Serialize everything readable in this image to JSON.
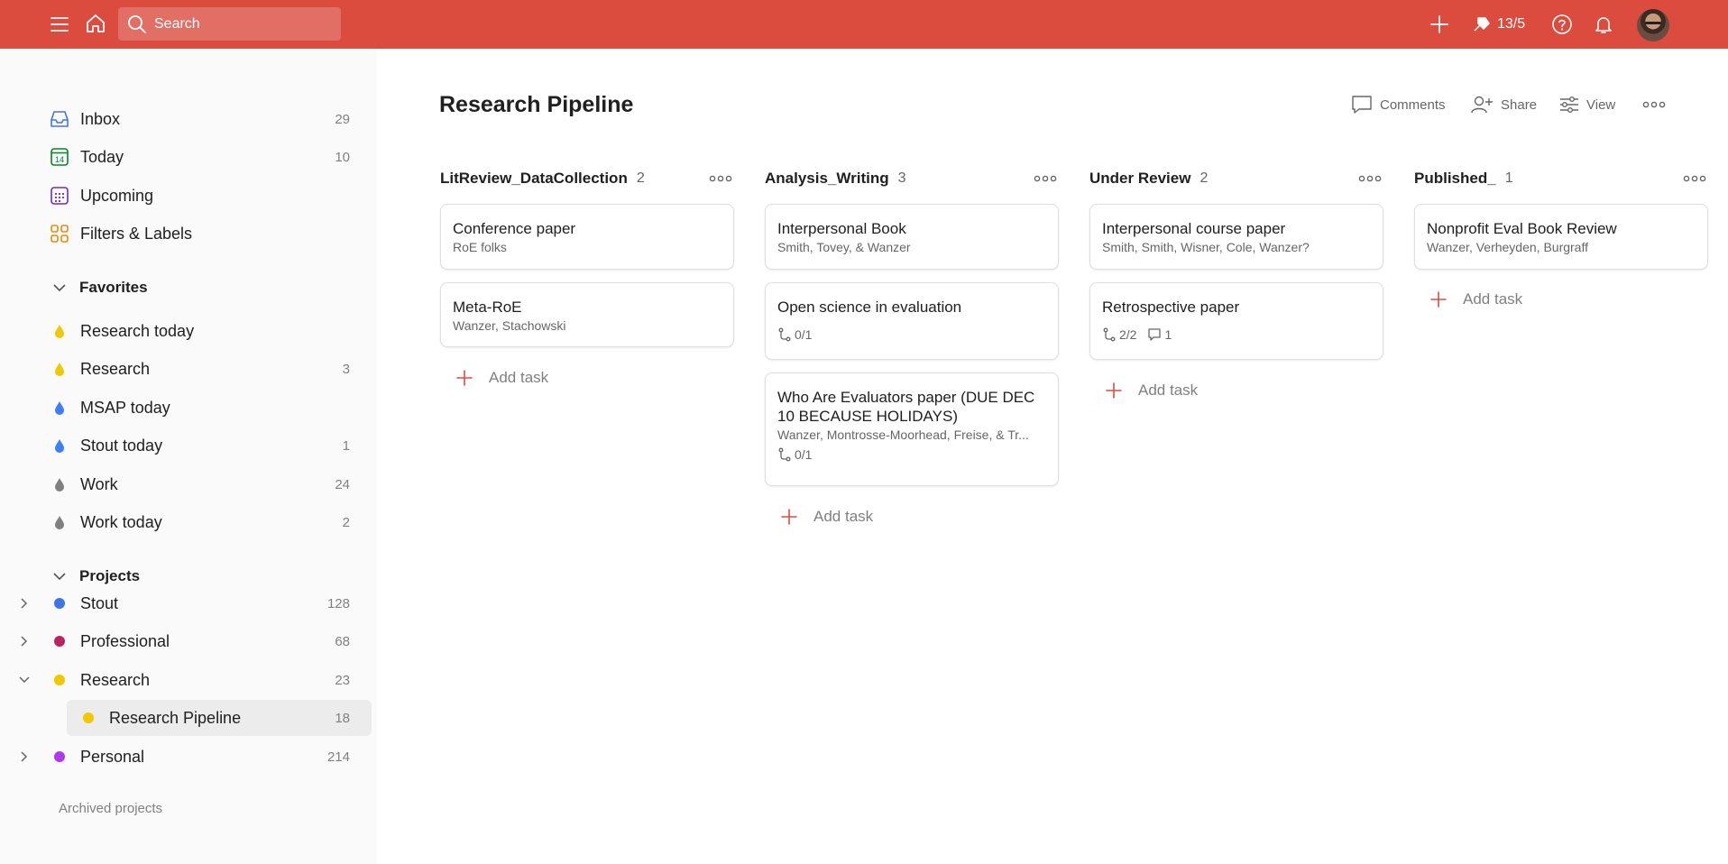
{
  "topbar": {
    "search_placeholder": "Search",
    "karma": "13/5",
    "icons": [
      "menu-icon",
      "home-icon",
      "search-icon",
      "plus-icon",
      "karma-icon",
      "help-icon",
      "bell-icon"
    ]
  },
  "sidebar": {
    "nav": [
      {
        "label": "Inbox",
        "count": "29",
        "icon": "inbox-icon"
      },
      {
        "label": "Today",
        "count": "10",
        "icon": "calendar-today-icon",
        "icon_text": "14"
      },
      {
        "label": "Upcoming",
        "count": "",
        "icon": "calendar-grid-icon"
      },
      {
        "label": "Filters & Labels",
        "count": "",
        "icon": "grid-icon"
      }
    ],
    "favorites_header": "Favorites",
    "favorites": [
      {
        "label": "Research today",
        "count": "",
        "color": "#f0c800"
      },
      {
        "label": "Research",
        "count": "3",
        "color": "#f0c800"
      },
      {
        "label": "MSAP today",
        "count": "",
        "color": "#3d7df5"
      },
      {
        "label": "Stout today",
        "count": "1",
        "color": "#3d7df5"
      },
      {
        "label": "Work",
        "count": "24",
        "color": "#808080"
      },
      {
        "label": "Work today",
        "count": "2",
        "color": "#808080"
      }
    ],
    "projects_header": "Projects",
    "projects": [
      {
        "label": "Stout",
        "count": "128",
        "color": "#4073e6"
      },
      {
        "label": "Professional",
        "count": "68",
        "color": "#b8255f"
      },
      {
        "label": "Research",
        "count": "23",
        "color": "#f0c800"
      },
      {
        "label": "Research Pipeline",
        "count": "18",
        "color": "#f0c800"
      },
      {
        "label": "Personal",
        "count": "214",
        "color": "#af38eb"
      }
    ],
    "archived": "Archived projects"
  },
  "main": {
    "title": "Research Pipeline",
    "actions": {
      "comments": "Comments",
      "share": "Share",
      "view": "View"
    },
    "add_task": "Add task",
    "columns": [
      {
        "name": "LitReview_DataCollection",
        "count": "2",
        "cards": [
          {
            "title": "Conference paper",
            "sub": "RoE folks"
          },
          {
            "title": "Meta-RoE",
            "sub": "Wanzer, Stachowski"
          }
        ]
      },
      {
        "name": "Analysis_Writing",
        "count": "3",
        "cards": [
          {
            "title": "Interpersonal Book",
            "sub": "Smith, Tovey, & Wanzer"
          },
          {
            "title": "Open science in evaluation",
            "subtasks": "0/1"
          },
          {
            "title": "Who Are Evaluators paper (DUE DEC 10 BECAUSE HOLIDAYS)",
            "sub": "Wanzer, Montrosse-Moorhead, Freise, & Tr...",
            "subtasks": "0/1"
          }
        ]
      },
      {
        "name": "Under Review",
        "count": "2",
        "cards": [
          {
            "title": "Interpersonal course paper",
            "sub": "Smith, Smith, Wisner, Cole, Wanzer?"
          },
          {
            "title": "Retrospective paper",
            "subtasks": "2/2",
            "comments": "1"
          }
        ]
      },
      {
        "name": "Published_",
        "count": "1",
        "cards": [
          {
            "title": "Nonprofit Eval Book Review",
            "sub": "Wanzer, Verheyden, Burgraff"
          }
        ]
      }
    ]
  }
}
